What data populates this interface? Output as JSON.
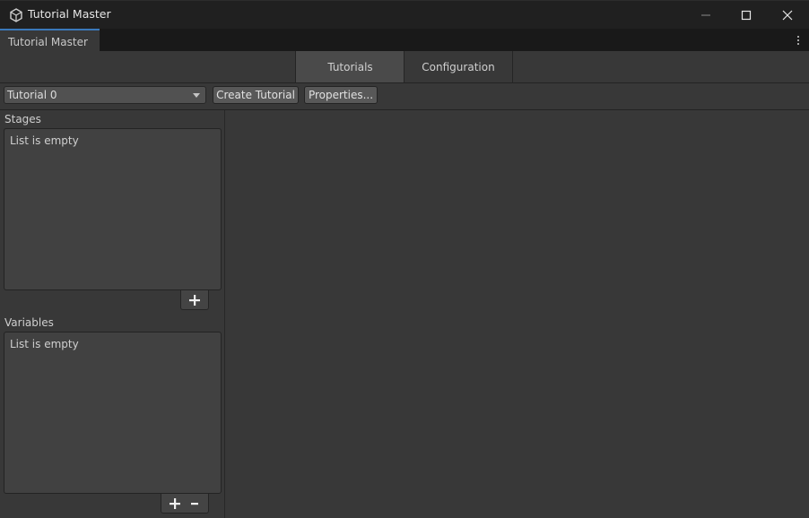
{
  "window": {
    "title": "Tutorial Master",
    "controls": {
      "minimize": "minimize-icon",
      "maximize": "maximize-icon",
      "close": "close-icon"
    }
  },
  "tabstrip": {
    "document_tab": "Tutorial Master",
    "menu_icon": "kebab-menu-icon"
  },
  "top_tabs": [
    {
      "label": "Tutorials",
      "active": true
    },
    {
      "label": "Configuration",
      "active": false
    }
  ],
  "toolbar": {
    "tutorial_select": "Tutorial 0",
    "create_label": "Create Tutorial",
    "properties_label": "Properties..."
  },
  "stages": {
    "label": "Stages",
    "empty_text": "List is empty",
    "add_icon": "plus-icon"
  },
  "variables": {
    "label": "Variables",
    "empty_text": "List is empty",
    "add_icon": "plus-icon",
    "remove_icon": "minus-icon"
  },
  "colors": {
    "tab_accent": "#3a79bb",
    "background": "#383838",
    "titlebar": "#202020"
  }
}
